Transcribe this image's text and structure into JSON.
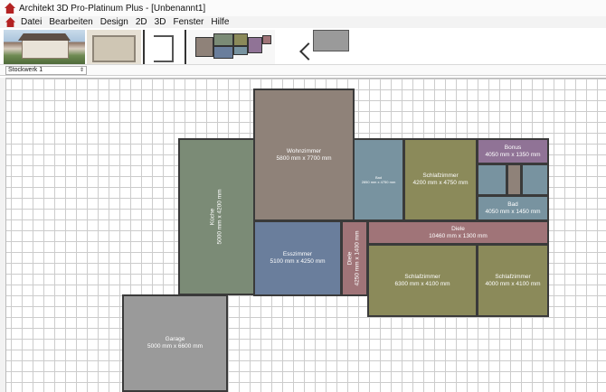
{
  "window": {
    "title": "Architekt 3D Pro-Platinum Plus - [Unbenannt1]"
  },
  "menu": [
    "Datei",
    "Bearbeiten",
    "Design",
    "2D",
    "3D",
    "Fenster",
    "Hilfe"
  ],
  "toolbar": {
    "thumbnails": [
      "house-3d-view",
      "floorplan-3d-view",
      "wireframe-view",
      "colored-plan-view",
      "room-block-view"
    ]
  },
  "floor_selector": {
    "value": "Stockwerk 1"
  },
  "colors": {
    "wohnzimmer": "#8f8279",
    "kueche": "#7b8b76",
    "esszimmer": "#6a7e9c",
    "bad": "#7893a0",
    "schlafzimmer": "#8b8a5a",
    "bonus": "#907396",
    "diele": "#a07478",
    "garage": "#9a9a9a"
  },
  "rooms": {
    "wohnzimmer": {
      "name": "Wohnzimmer",
      "size": "5800 mm x 7700 mm"
    },
    "kueche": {
      "name": "Küche",
      "size": "5000 mm x 4200 mm"
    },
    "esszimmer": {
      "name": "Esszimmer",
      "size": "5100 mm x 4250 mm"
    },
    "diele_small": {
      "name": "Diele",
      "size": "4250 mm x 1400 mm"
    },
    "bad_left": {
      "name": "Bad",
      "size": "2850 mm x 4750 mm"
    },
    "schlafzimmer_top": {
      "name": "Schlafzimmer",
      "size": "4200 mm x 4750 mm"
    },
    "bonus": {
      "name": "Bonus",
      "size": "4050 mm x 1350 mm"
    },
    "bad_right": {
      "name": "Bad",
      "size": "4050 mm x 1450 mm"
    },
    "diele": {
      "name": "Diele",
      "size": "10460 mm x 1300 mm"
    },
    "schlafzimmer_bl": {
      "name": "Schlafzimmer",
      "size": "6300 mm x 4100 mm"
    },
    "schlafzimmer_br": {
      "name": "Schlafzimmer",
      "size": "4000 mm x 4100 mm"
    },
    "garage": {
      "name": "Garage",
      "size": "5000 mm x 6600 mm"
    }
  }
}
